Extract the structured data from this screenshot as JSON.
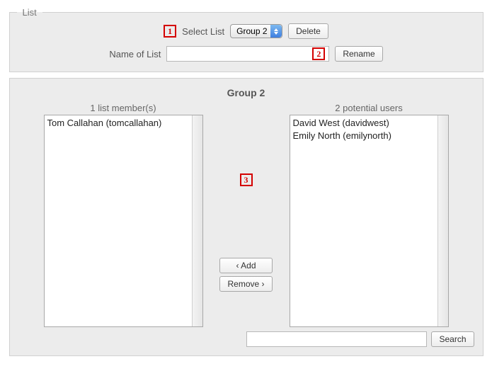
{
  "fieldset": {
    "legend": "List",
    "select_label": "Select List",
    "selected_list": "Group 2",
    "delete_label": "Delete",
    "name_label": "Name of List",
    "name_value": "",
    "rename_label": "Rename"
  },
  "callouts": {
    "one": "1",
    "two": "2",
    "three": "3"
  },
  "group": {
    "title": "Group 2",
    "members_caption": "1 list member(s)",
    "members": [
      "Tom Callahan (tomcallahan)"
    ],
    "potential_caption": "2 potential users",
    "potential": [
      "David West (davidwest)",
      "Emily North (emilynorth)"
    ],
    "add_label": "‹ Add",
    "remove_label": "Remove ›",
    "search_value": "",
    "search_label": "Search"
  }
}
